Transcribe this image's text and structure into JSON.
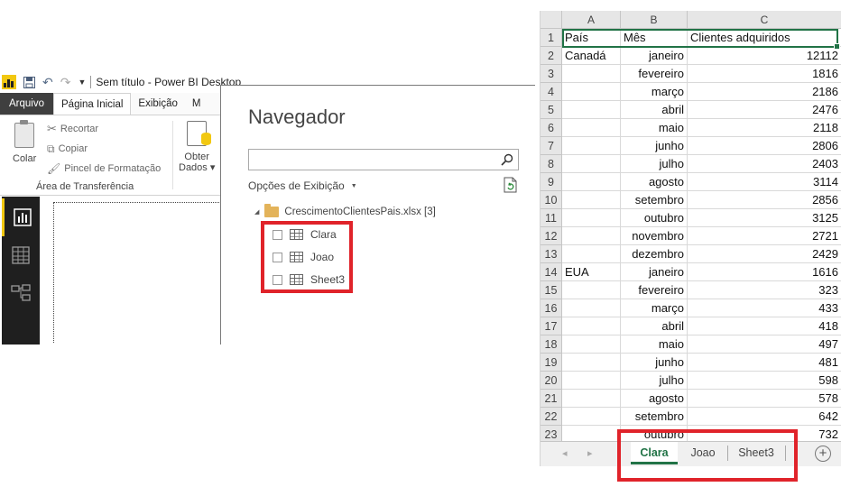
{
  "pbi": {
    "title": "Sem título - Power BI Desktop",
    "tabs": [
      "Arquivo",
      "Página Inicial",
      "Exibição",
      "M"
    ],
    "ribbon": {
      "paste_label": "Colar",
      "cut_label": "Recortar",
      "copy_label": "Copiar",
      "format_painter_label": "Pincel de Formatação",
      "clipboard_group_label": "Área de Transferência",
      "get_data_line1": "Obter",
      "get_data_line2": "Dados ▾"
    },
    "sidebar": [
      "report-view",
      "data-view",
      "model-view"
    ]
  },
  "navigator": {
    "title": "Navegador",
    "search_placeholder": "",
    "display_options_label": "Opções de Exibição",
    "file_label": "CrescimentoClientesPais.xlsx [3]",
    "items": [
      "Clara",
      "Joao",
      "Sheet3"
    ]
  },
  "excel": {
    "columns": [
      "A",
      "B",
      "C"
    ],
    "rows": [
      {
        "n": "1",
        "a": "País",
        "b": "Mês",
        "c": "Clientes adquiridos"
      },
      {
        "n": "2",
        "a": "Canadá",
        "b": "janeiro",
        "c": "12112"
      },
      {
        "n": "3",
        "a": "",
        "b": "fevereiro",
        "c": "1816"
      },
      {
        "n": "4",
        "a": "",
        "b": "março",
        "c": "2186"
      },
      {
        "n": "5",
        "a": "",
        "b": "abril",
        "c": "2476"
      },
      {
        "n": "6",
        "a": "",
        "b": "maio",
        "c": "2118"
      },
      {
        "n": "7",
        "a": "",
        "b": "junho",
        "c": "2806"
      },
      {
        "n": "8",
        "a": "",
        "b": "julho",
        "c": "2403"
      },
      {
        "n": "9",
        "a": "",
        "b": "agosto",
        "c": "3114"
      },
      {
        "n": "10",
        "a": "",
        "b": "setembro",
        "c": "2856"
      },
      {
        "n": "11",
        "a": "",
        "b": "outubro",
        "c": "3125"
      },
      {
        "n": "12",
        "a": "",
        "b": "novembro",
        "c": "2721"
      },
      {
        "n": "13",
        "a": "",
        "b": "dezembro",
        "c": "2429"
      },
      {
        "n": "14",
        "a": "EUA",
        "b": "janeiro",
        "c": "1616"
      },
      {
        "n": "15",
        "a": "",
        "b": "fevereiro",
        "c": "323"
      },
      {
        "n": "16",
        "a": "",
        "b": "março",
        "c": "433"
      },
      {
        "n": "17",
        "a": "",
        "b": "abril",
        "c": "418"
      },
      {
        "n": "18",
        "a": "",
        "b": "maio",
        "c": "497"
      },
      {
        "n": "19",
        "a": "",
        "b": "junho",
        "c": "481"
      },
      {
        "n": "20",
        "a": "",
        "b": "julho",
        "c": "598"
      },
      {
        "n": "21",
        "a": "",
        "b": "agosto",
        "c": "578"
      },
      {
        "n": "22",
        "a": "",
        "b": "setembro",
        "c": "642"
      },
      {
        "n": "23",
        "a": "",
        "b": "outubro",
        "c": "732"
      }
    ],
    "sheet_tabs": [
      "Clara",
      "Joao",
      "Sheet3"
    ],
    "active_sheet": "Clara"
  },
  "colors": {
    "excel_green": "#217346",
    "highlight_red": "#e0232a",
    "pbi_yellow": "#f2c811"
  }
}
